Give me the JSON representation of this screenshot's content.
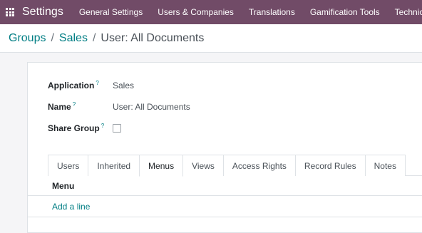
{
  "navbar": {
    "app_name": "Settings",
    "menu": [
      "General Settings",
      "Users & Companies",
      "Translations",
      "Gamification Tools",
      "Technical"
    ]
  },
  "breadcrumb": {
    "items": [
      "Groups",
      "Sales"
    ],
    "separator": "/",
    "current": "User: All Documents"
  },
  "form": {
    "application": {
      "label": "Application",
      "help": "?",
      "value": "Sales"
    },
    "name": {
      "label": "Name",
      "help": "?",
      "value": "User: All Documents"
    },
    "share_group": {
      "label": "Share Group",
      "help": "?",
      "checked": false
    }
  },
  "tabs": [
    "Users",
    "Inherited",
    "Menus",
    "Views",
    "Access Rights",
    "Record Rules",
    "Notes"
  ],
  "active_tab": "Menus",
  "list": {
    "column": "Menu",
    "add_line": "Add a line"
  },
  "colors": {
    "navbar": "#714b67",
    "link": "#017e84"
  }
}
